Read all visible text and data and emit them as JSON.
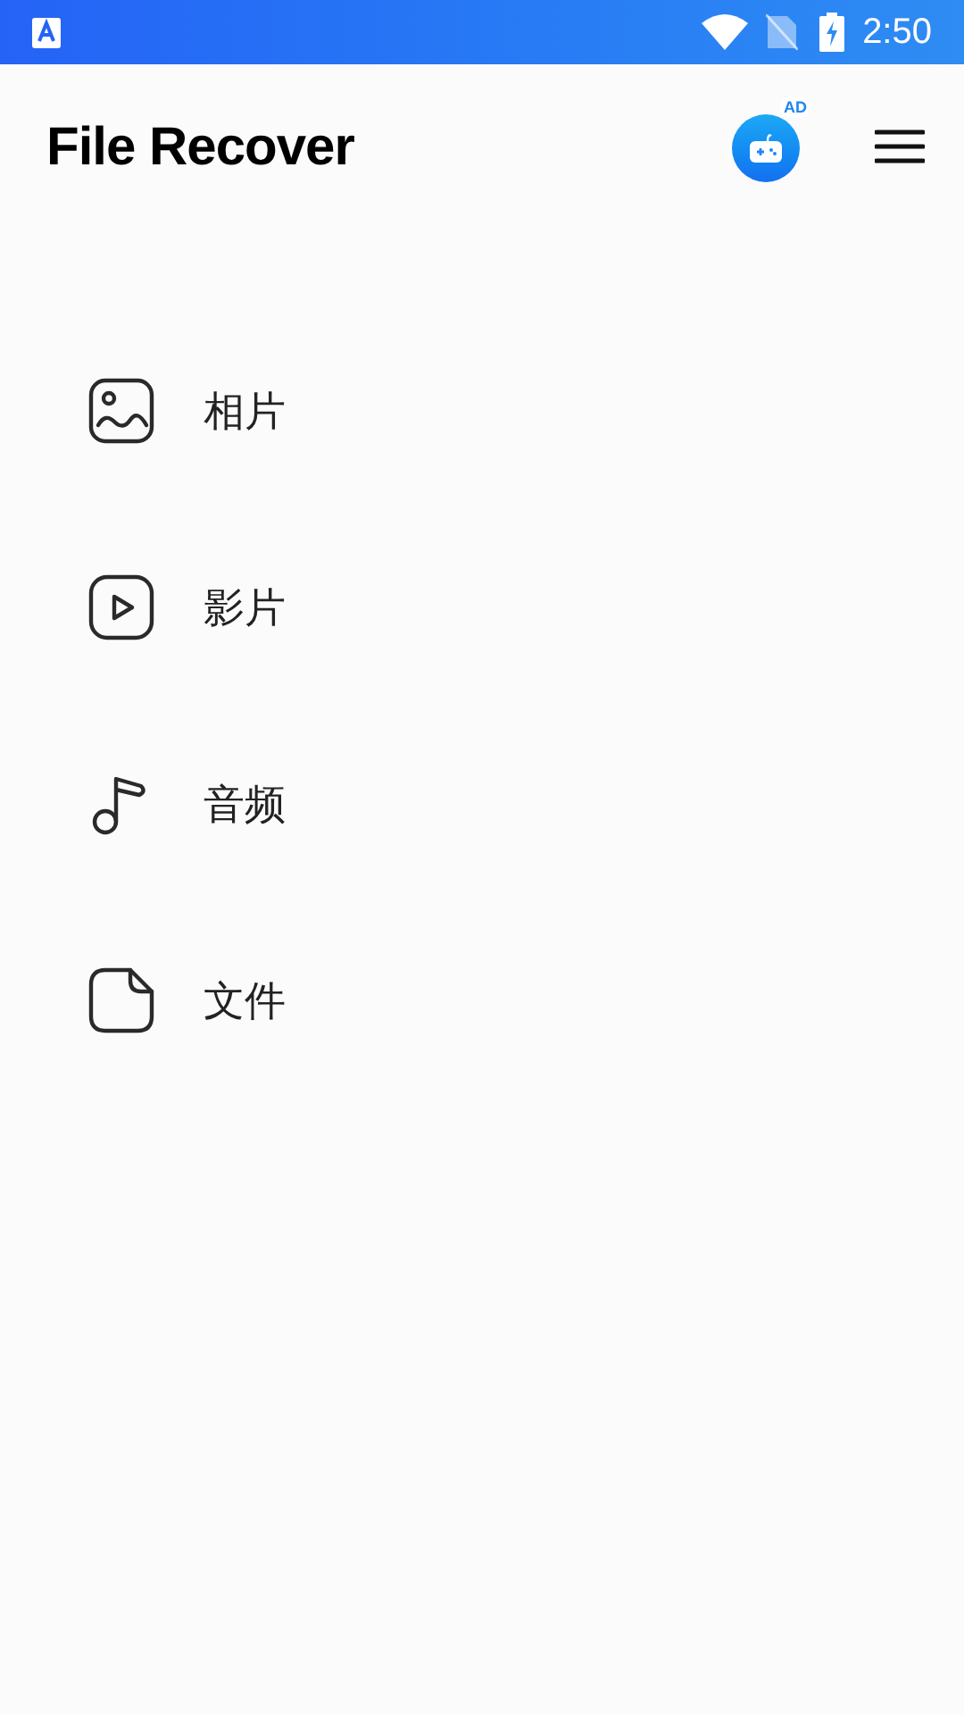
{
  "status_bar": {
    "time": "2:50"
  },
  "app_bar": {
    "title": "File Recover",
    "ad_badge": "AD"
  },
  "categories": [
    {
      "kind": "image",
      "label": "相片"
    },
    {
      "kind": "video",
      "label": "影片"
    },
    {
      "kind": "audio",
      "label": "音频"
    },
    {
      "kind": "document",
      "label": "文件"
    }
  ]
}
